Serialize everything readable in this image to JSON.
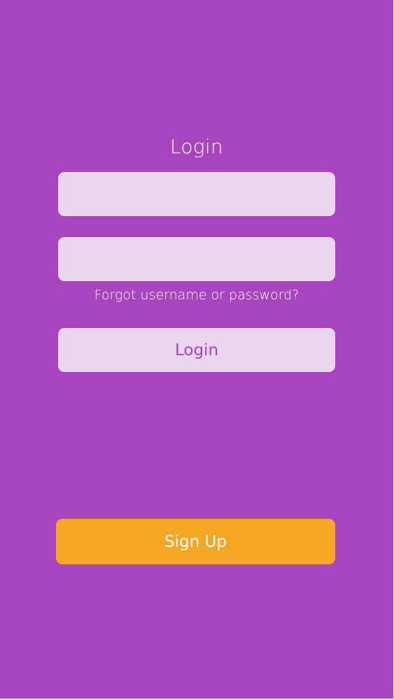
{
  "login": {
    "title": "Login",
    "username": {
      "value": "",
      "placeholder": ""
    },
    "password": {
      "value": "",
      "placeholder": ""
    },
    "forgot_link": "Forgot username or password?",
    "login_button": "Login",
    "signup_button": "Sign Up"
  },
  "colors": {
    "background": "#a844bd",
    "input_fill": "#ead6ef",
    "login_button_text": "#a844bd",
    "signup_button": "#f5a623",
    "text": "#ffffff"
  }
}
